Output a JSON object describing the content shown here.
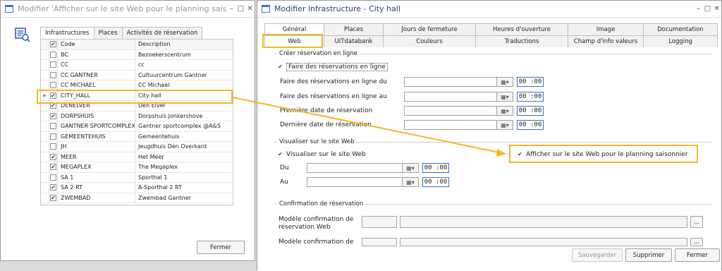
{
  "left_window": {
    "title": "Modifier 'Afficher sur le site Web pour le planning saisonni...",
    "controls": [
      "–",
      "□",
      "✕"
    ],
    "tabs": [
      "Infrastructures",
      "Places",
      "Activités de réservation"
    ],
    "columns": {
      "code": "Code",
      "description": "Description"
    },
    "rows": [
      {
        "code": "BC",
        "desc": "Bezoekerscentrum",
        "checked": false
      },
      {
        "code": "CC",
        "desc": "cc",
        "checked": false
      },
      {
        "code": "CC GANTNER",
        "desc": "Cultuurcentrum Gantner",
        "checked": false
      },
      {
        "code": "CC MICHAEL",
        "desc": "CC Michael",
        "checked": false
      },
      {
        "code": "CITY_HALL",
        "desc": "City hall",
        "checked": true
      },
      {
        "code": "DENELVER",
        "desc": "Den Elver",
        "checked": true
      },
      {
        "code": "DORPSHUIS",
        "desc": "Dorpshuis Jonkershove",
        "checked": true
      },
      {
        "code": "GANTNER SPORTCOMPLEX",
        "desc": "Gantner sportcomplex @A&S",
        "checked": false
      },
      {
        "code": "GEMEENTEHUIS",
        "desc": "Gemeentehuis",
        "checked": false
      },
      {
        "code": "JH",
        "desc": "Jeugdhuis Den Overkant",
        "checked": false
      },
      {
        "code": "MEER",
        "desc": "Het Meer",
        "checked": true
      },
      {
        "code": "MEGAPLEX",
        "desc": "The Megaplex",
        "checked": true
      },
      {
        "code": "SA 1",
        "desc": "Sporthal 1",
        "checked": false
      },
      {
        "code": "SA 2-RT",
        "desc": "A-Sporthal 2 RT",
        "checked": true
      },
      {
        "code": "ZWEMBAD",
        "desc": "Zwembad Gantner",
        "checked": true
      }
    ],
    "close_button": "Fermer"
  },
  "right_window": {
    "title": "Modifier infrastructure - City hall",
    "controls": [
      "–",
      "□",
      "✕"
    ],
    "tabs_row1": [
      "Général",
      "Places",
      "Jours de fermeture",
      "Heures d'ouverture",
      "Image",
      "Documentation"
    ],
    "tabs_row2": [
      "Web",
      "UITdatabank",
      "Couleurs",
      "Traductions",
      "Champ d'info valeurs",
      "Logging"
    ],
    "online": {
      "group_title": "Créer réservation en ligne",
      "checkbox": "Faire des réservations en ligne",
      "fields": [
        {
          "label": "Faire des réservations en ligne du",
          "time": "00 :00"
        },
        {
          "label": "Faire des réservations en ligne au",
          "time": "00 :00"
        },
        {
          "label": "Première date de réservation",
          "time": "00 :00"
        },
        {
          "label": "Dernière date de réservation",
          "time": "00 :00"
        }
      ]
    },
    "web": {
      "group_title": "Visualiser sur le site Web",
      "checkbox": "Visualiser sur le site Web",
      "seasonal_checkbox": "Afficher sur le site Web pour le planning saisonnier",
      "fields": [
        {
          "label": "Du",
          "time": "00 :00"
        },
        {
          "label": "Au",
          "time": "00 :00"
        }
      ]
    },
    "confirm": {
      "group_title": "Confirmation de réservation",
      "field1": "Modèle confirmation de réservation Web",
      "field2": "Modèle confirmation de",
      "ellipsis": "..."
    },
    "buttons": {
      "save": "Sauvegarder",
      "delete": "Supprimer",
      "close": "Fermer"
    }
  },
  "colors": {
    "highlight": "#f2b824",
    "accent": "#3a6fc8"
  }
}
